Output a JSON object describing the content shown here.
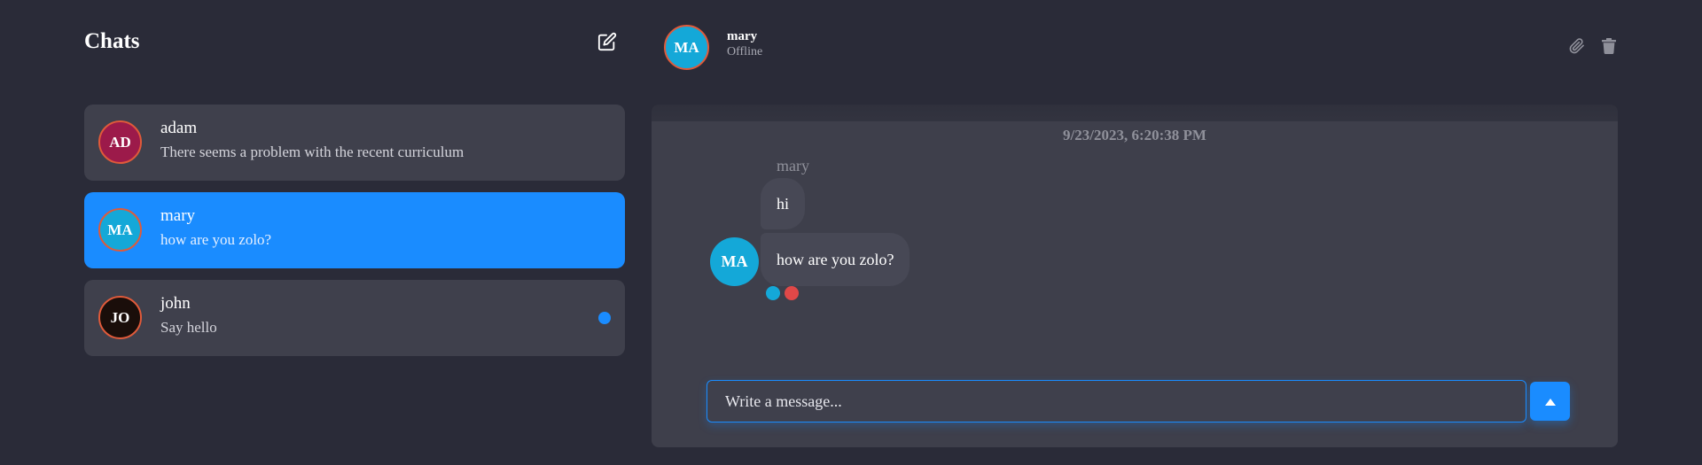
{
  "sidebar": {
    "title": "Chats",
    "new_chat_icon": "edit-icon",
    "items": [
      {
        "initials": "AD",
        "name": "adam",
        "preview": "There seems a problem with the recent curriculum",
        "avatar_color": "#9c1a4a",
        "active": false,
        "unread": false
      },
      {
        "initials": "MA",
        "name": "mary",
        "preview": "how are you zolo?",
        "avatar_color": "#14a8d8",
        "active": true,
        "unread": false
      },
      {
        "initials": "JO",
        "name": "john",
        "preview": "Say hello",
        "avatar_color": "#1a0e0a",
        "active": false,
        "unread": true
      }
    ]
  },
  "header": {
    "initials": "MA",
    "name": "mary",
    "status": "Offline",
    "attach_icon": "paperclip-icon",
    "delete_icon": "trash-icon"
  },
  "conversation": {
    "timestamp": "9/23/2023, 6:20:38 PM",
    "sender": "mary",
    "sender_initials": "MA",
    "messages": [
      "hi",
      "how are you zolo?"
    ],
    "reaction_colors": [
      "#14a8d8",
      "#e04848"
    ]
  },
  "composer": {
    "placeholder": "Write a message...",
    "send_icon": "caret-up-icon"
  },
  "colors": {
    "accent": "#1a8cff",
    "background": "#2a2b38",
    "panel": "#3e3f4b"
  }
}
